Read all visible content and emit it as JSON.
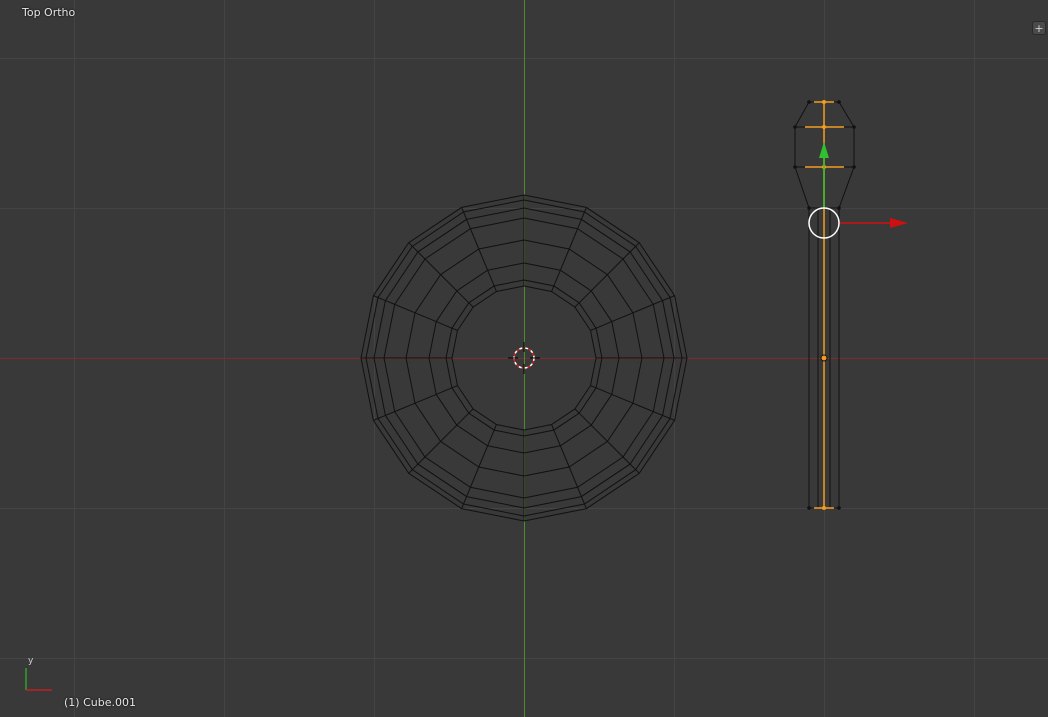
{
  "viewport": {
    "view_label": "Top Ortho",
    "object_info": "(1) Cube.001",
    "plus_symbol": "+",
    "axis_widget": {
      "y_label": "y"
    }
  },
  "colors": {
    "background": "#393939",
    "grid": "#444444",
    "x_axis": "#7a2e2e",
    "y_axis": "#4c8a2a",
    "wire": "#111111",
    "selected": "#f39c1f",
    "gizmo_x": "#d01010",
    "gizmo_y": "#30c030"
  }
}
